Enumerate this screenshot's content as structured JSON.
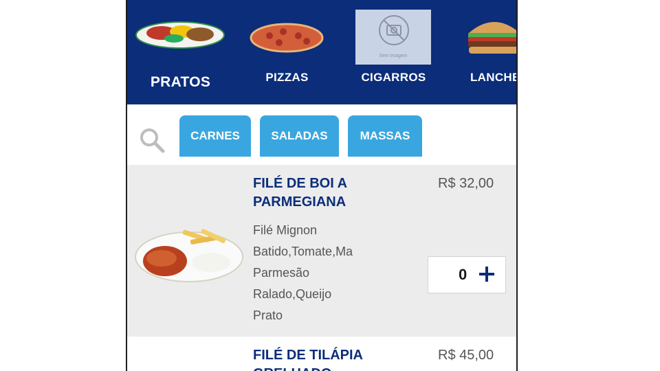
{
  "categories": [
    {
      "label": "PRATOS",
      "icon": "plate-food-image",
      "active": true
    },
    {
      "label": "PIZZAS",
      "icon": "pizza-image"
    },
    {
      "label": "CIGARROS",
      "icon": "no-image-placeholder",
      "placeholder_text": "Sem imagem"
    },
    {
      "label": "LANCHES",
      "icon": "burger-image"
    }
  ],
  "filters": {
    "search_icon": "search-icon",
    "chips": [
      "CARNES",
      "SALADAS",
      "MASSAS"
    ]
  },
  "products": [
    {
      "name": "FILÉ DE BOI A PARMEGIANA",
      "price": "R$ 32,00",
      "description": "Filé Mignon\nBatido,Tomate,Ma\nParmesão\nRalado,Queijo\nPrato",
      "quantity": "0",
      "image": "parmigiana-plate-image"
    },
    {
      "name": "FILÉ DE TILÁPIA GRELHADO",
      "price": "R$ 45,00"
    }
  ],
  "colors": {
    "header_bg": "#0b2d7a",
    "chip_bg": "#3aa6e0",
    "card_bg": "#ececec",
    "title_text": "#0b2d7a"
  }
}
